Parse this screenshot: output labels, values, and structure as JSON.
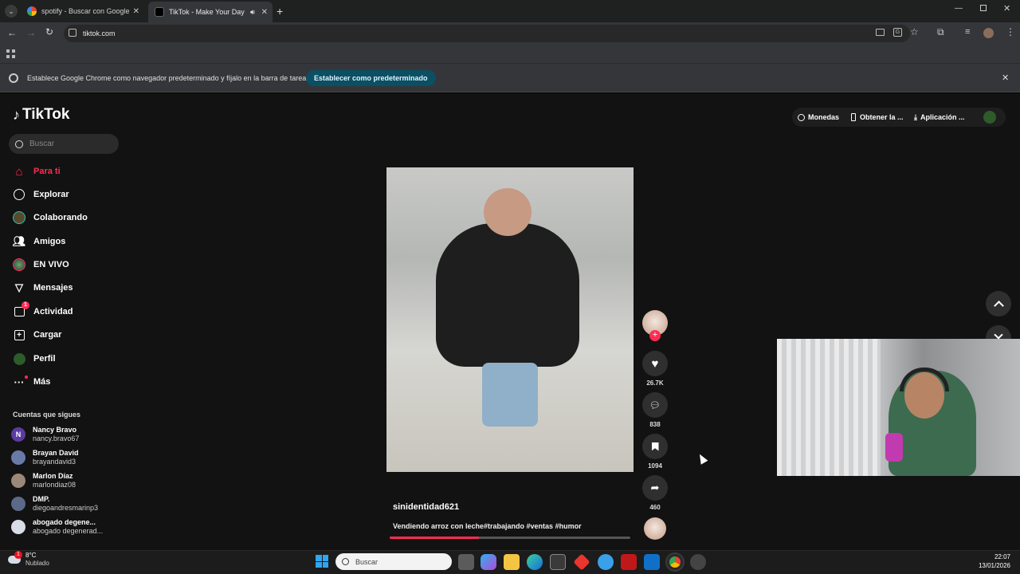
{
  "browser": {
    "tabs": [
      {
        "title": "spotify - Buscar con Google"
      },
      {
        "title": "TikTok - Make Your Day"
      }
    ],
    "url": "tiktok.com",
    "infobar": {
      "message": "Establece Google Chrome como navegador predeterminado y fíjalo en la barra de tareas",
      "button": "Establecer como predeterminado"
    }
  },
  "tiktok": {
    "logo": "TikTok",
    "search_placeholder": "Buscar",
    "header": {
      "coins": "Monedas",
      "get_app": "Obtener la ...",
      "download": "Aplicación ..."
    },
    "nav": [
      {
        "label": "Para ti",
        "icon": "home-icon",
        "color": "#fe2c55"
      },
      {
        "label": "Explorar",
        "icon": "compass-icon"
      },
      {
        "label": "Colaborando",
        "icon": "collab-icon"
      },
      {
        "label": "Amigos",
        "icon": "friends-icon"
      },
      {
        "label": "EN VIVO",
        "icon": "live-icon"
      },
      {
        "label": "Mensajes",
        "icon": "send-icon"
      },
      {
        "label": "Actividad",
        "icon": "activity-icon",
        "badge": "1"
      },
      {
        "label": "Cargar",
        "icon": "upload-icon"
      },
      {
        "label": "Perfil",
        "icon": "profile-icon"
      },
      {
        "label": "Más",
        "icon": "more-icon"
      }
    ],
    "following_title": "Cuentas que sigues",
    "following": [
      {
        "name": "Nancy Bravo",
        "handle": "nancy.bravo67",
        "initial": "N"
      },
      {
        "name": "Brayan David",
        "handle": "brayandavid3"
      },
      {
        "name": "Marlon Díaz",
        "handle": "marlondiaz08"
      },
      {
        "name": "DMP.",
        "handle": "diegoandresmarinp3"
      },
      {
        "name": "abogado degene...",
        "handle": "abogado degenerad..."
      }
    ],
    "video": {
      "author": "sinidentidad621",
      "caption": "Vendiendo arroz con leche#trabajando #ventas #humor",
      "progress": 0.37,
      "likes": "26.7K",
      "comments": "838",
      "saves": "1094",
      "shares": "460"
    }
  },
  "taskbar": {
    "weather_temp": "8°C",
    "weather_desc": "Nublado",
    "search": "Buscar",
    "time": "22:07",
    "date": "13/01/2026"
  },
  "colors": {
    "accent": "#fe2c55",
    "chrome_dark": "#35363a",
    "infobar_button": "#0b4f63"
  }
}
